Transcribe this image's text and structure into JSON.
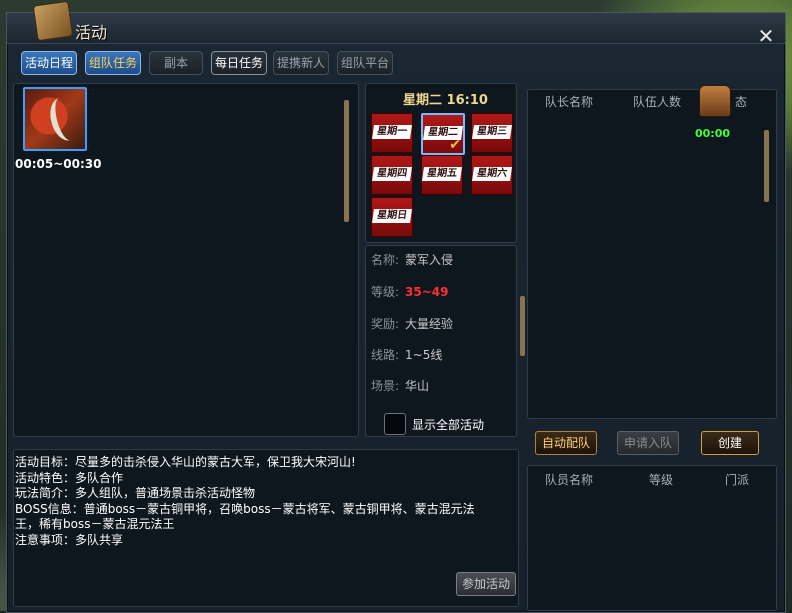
{
  "window": {
    "title": "活动",
    "title_icon": "activity-scroll-icon",
    "close_icon": "close-icon",
    "close_glyph": "✕"
  },
  "tabs": [
    {
      "label": "活动日程",
      "active": true
    },
    {
      "label": "组队任务",
      "active": true,
      "accent": "#ffd050"
    },
    {
      "label": "副本",
      "active": false
    },
    {
      "label": "每日任务",
      "active": false
    },
    {
      "label": "提携新人",
      "active": false
    },
    {
      "label": "组队平台",
      "active": false
    }
  ],
  "activity_list": [
    {
      "icon": "warrior-blade-icon",
      "time": "00:05~00:30",
      "selected": true
    }
  ],
  "schedule": {
    "current_day_time": "星期二 16:10",
    "days": [
      {
        "label": "星期一",
        "selected": false
      },
      {
        "label": "星期二",
        "selected": true
      },
      {
        "label": "星期三",
        "selected": false
      },
      {
        "label": "星期四",
        "selected": false
      },
      {
        "label": "星期五",
        "selected": false
      },
      {
        "label": "星期六",
        "selected": false
      },
      {
        "label": "星期日",
        "selected": false
      }
    ],
    "checkmark": "✔"
  },
  "details": {
    "name_label": "名称:",
    "name": "蒙军入侵",
    "level_label": "等级:",
    "level": "35~49",
    "reward_label": "奖励:",
    "reward": "大量经验",
    "line_label": "线路:",
    "line": "1~5线",
    "scene_label": "场景:",
    "scene": "华山"
  },
  "show_all": {
    "label": "显示全部活动",
    "checked": false
  },
  "team_list": {
    "headers": [
      "队长名称",
      "队伍人数",
      "态"
    ],
    "chest_time": "00:00",
    "chest_icon": "treasure-chest-icon"
  },
  "team_buttons": {
    "auto_match": "自动配队",
    "apply": "申请入队",
    "create": "创建"
  },
  "member_list": {
    "headers": [
      "队员名称",
      "等级",
      "门派"
    ]
  },
  "description": [
    "活动目标：尽量多的击杀侵入华山的蒙古大军，保卫我大宋河山!",
    "活动特色：多队合作",
    "玩法简介：多人组队，普通场景击杀活动怪物",
    "BOSS信息：普通boss－蒙古铜甲将，召唤boss－蒙古将军、蒙古铜甲将、蒙古混元法",
    "王，稀有boss－蒙古混元法王",
    "注意事项：多队共享"
  ],
  "join_button": "参加活动",
  "colors": {
    "accent_blue": "#3aa0ff",
    "level_red": "#ff3030",
    "timer_green": "#40ff40",
    "gold": "#f0d890"
  }
}
